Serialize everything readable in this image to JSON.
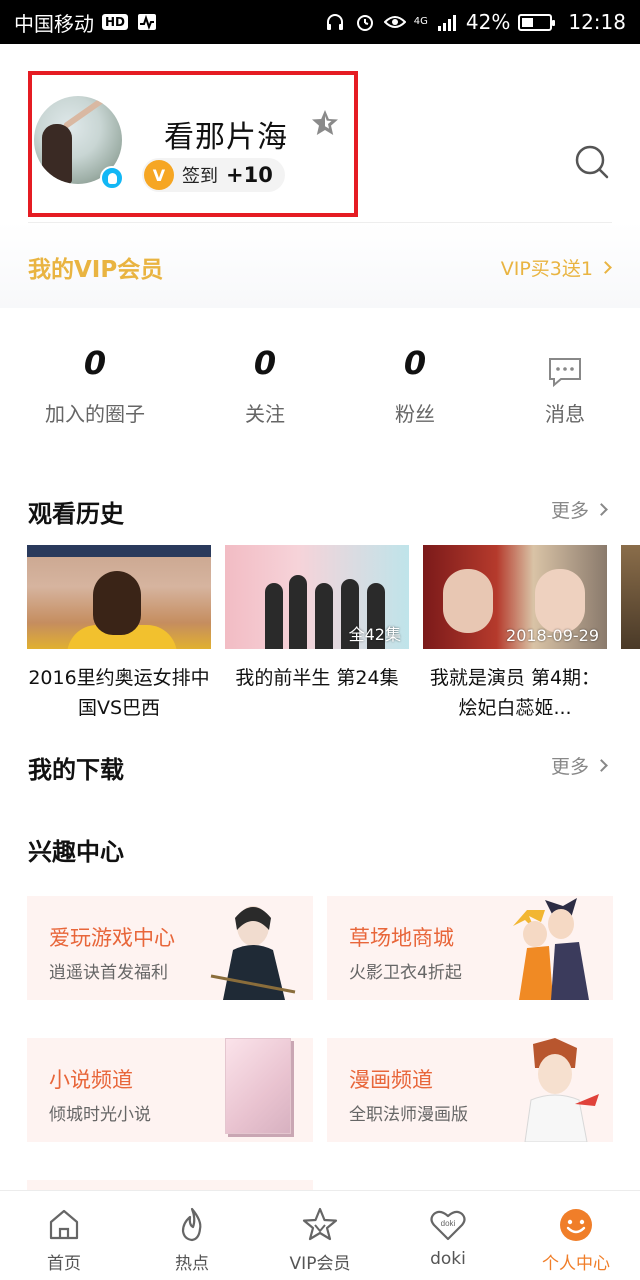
{
  "status_bar": {
    "carrier": "中国移动",
    "hd_badge": "HD",
    "network": "4G",
    "battery": "42%",
    "battery_level": 0.42,
    "time": "12:18"
  },
  "profile": {
    "username": "看那片海",
    "checkin_badge": "V",
    "checkin_label": "签到",
    "checkin_points": "+10"
  },
  "vip": {
    "title": "我的VIP会员",
    "promo": "VIP买3送1"
  },
  "stats": [
    {
      "value": "0",
      "label": "加入的圈子"
    },
    {
      "value": "0",
      "label": "关注"
    },
    {
      "value": "0",
      "label": "粉丝"
    },
    {
      "label": "消息"
    }
  ],
  "history": {
    "title": "观看历史",
    "more": "更多",
    "items": [
      {
        "title": "2016里约奥运女排中国VS巴西",
        "tag": ""
      },
      {
        "title": "我的前半生 第24集",
        "tag": "全42集"
      },
      {
        "title": "我就是演员 第4期：烩妃白蕊姬...",
        "tag": "2018-09-29"
      }
    ]
  },
  "downloads": {
    "title": "我的下载",
    "more": "更多"
  },
  "interest": {
    "title": "兴趣中心",
    "cards": [
      {
        "title": "爱玩游戏中心",
        "subtitle": "逍遥诀首发福利"
      },
      {
        "title": "草场地商城",
        "subtitle": "火影卫衣4折起"
      },
      {
        "title": "小说频道",
        "subtitle": "倾城时光小说"
      },
      {
        "title": "漫画频道",
        "subtitle": "全职法师漫画版"
      }
    ]
  },
  "tabbar": {
    "active": "个人中心",
    "tabs": [
      {
        "label": "首页",
        "icon": "home-icon"
      },
      {
        "label": "热点",
        "icon": "flame-icon"
      },
      {
        "label": "VIP会员",
        "icon": "vip-star-icon"
      },
      {
        "label": "doki",
        "icon": "doki-heart-icon"
      },
      {
        "label": "个人中心",
        "icon": "smiley-icon"
      }
    ]
  },
  "colors": {
    "vip_gold": "#e9b441",
    "card_title": "#e8663a",
    "active_tab": "#f07e29",
    "highlight": "#e51c23",
    "qq_blue": "#12b7f5"
  }
}
